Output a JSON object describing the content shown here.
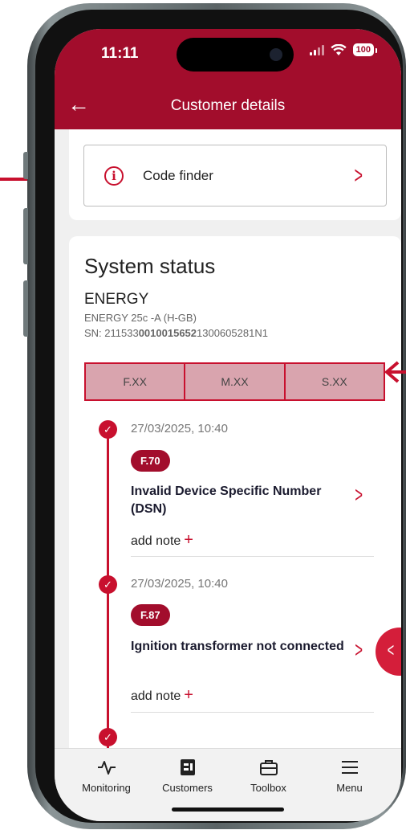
{
  "status_bar": {
    "time": "11:11",
    "battery": "100"
  },
  "header": {
    "title": "Customer details"
  },
  "code_finder": {
    "label": "Code finder"
  },
  "system_status": {
    "title": "System status",
    "device_name": "ENERGY",
    "device_model": "ENERGY 25c -A (H-GB)",
    "sn_prefix": "SN: 211533",
    "sn_bold": "0010015652",
    "sn_suffix": "1300605281N1"
  },
  "filter_tabs": [
    "F.XX",
    "M.XX",
    "S.XX"
  ],
  "events": [
    {
      "date": "27/03/2025, 10:40",
      "code": "F.70",
      "title": "Invalid Device Specific Number (DSN)",
      "add_note": "add note"
    },
    {
      "date": "27/03/2025, 10:40",
      "code": "F.87",
      "title": "Ignition transformer not connected",
      "add_note": "add note"
    }
  ],
  "bottom_nav": [
    {
      "label": "Monitoring",
      "icon": "monitoring-icon"
    },
    {
      "label": "Customers",
      "icon": "customers-icon"
    },
    {
      "label": "Toolbox",
      "icon": "toolbox-icon"
    },
    {
      "label": "Menu",
      "icon": "menu-icon"
    }
  ],
  "colors": {
    "brand": "#a20d2c",
    "accent": "#c8102e",
    "tab_fill": "#d9a4ae"
  }
}
